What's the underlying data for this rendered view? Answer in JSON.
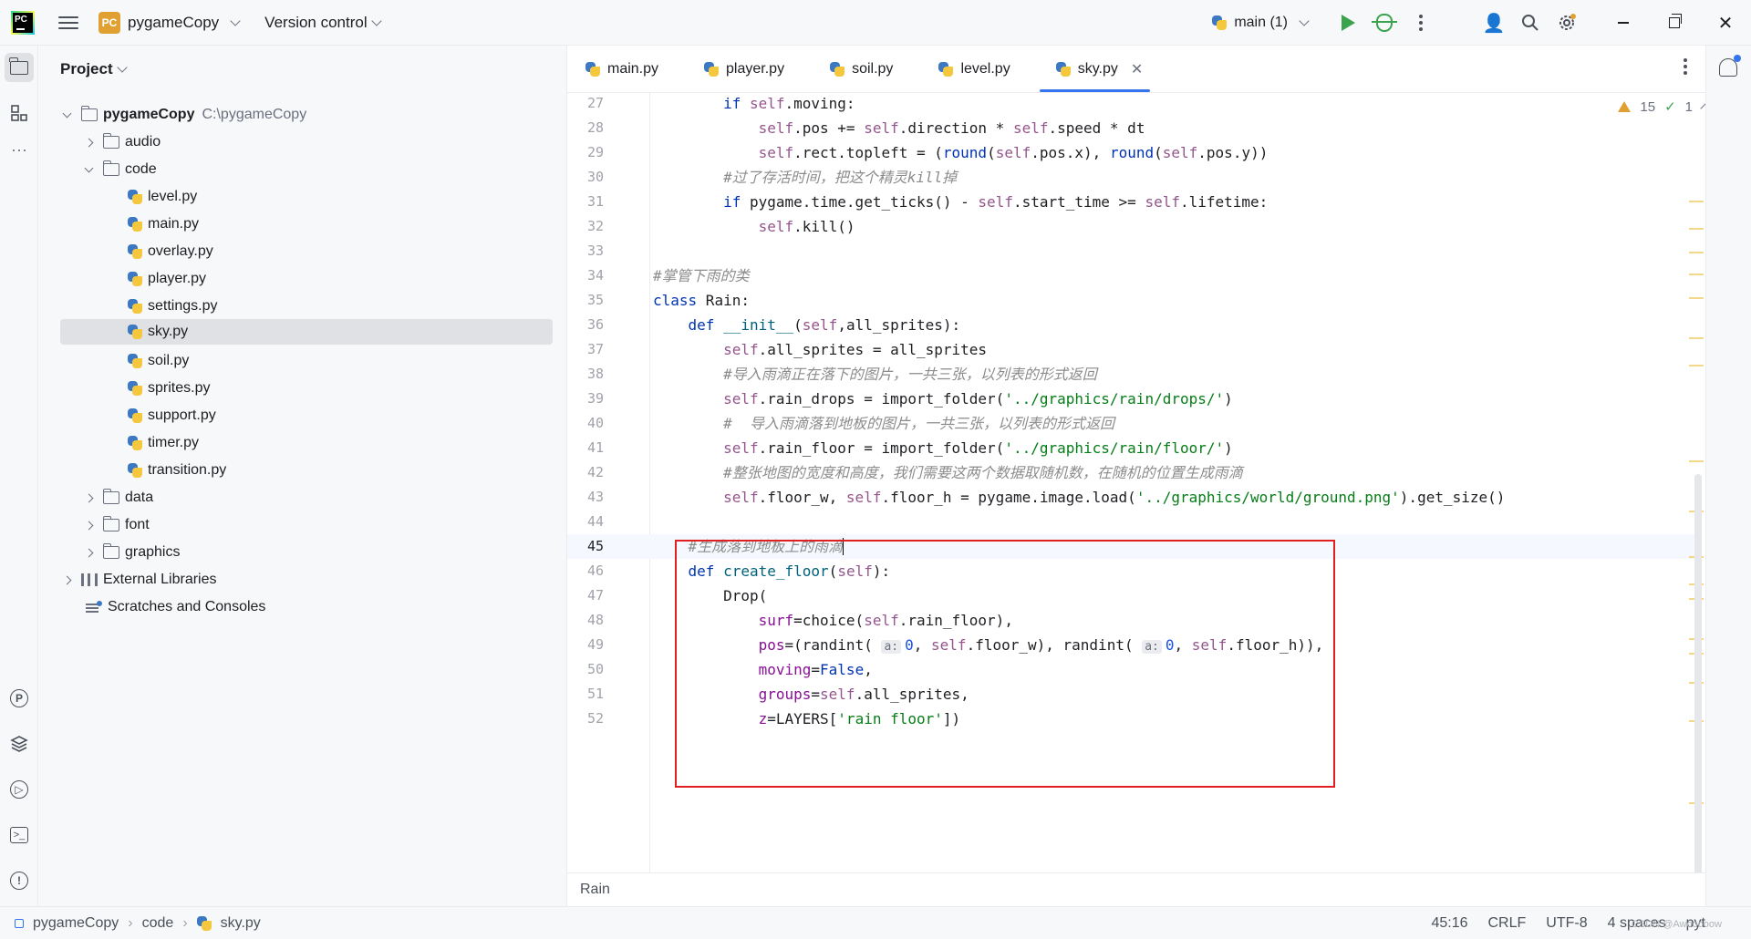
{
  "titlebar": {
    "project_badge": "PC",
    "project_name": "pygameCopy",
    "vcs_label": "Version control",
    "run_config": "main (1)"
  },
  "project_panel": {
    "title": "Project",
    "root_name": "pygameCopy",
    "root_path": "C:\\pygameCopy",
    "items": [
      {
        "label": "audio"
      },
      {
        "label": "code"
      },
      {
        "label": "level.py"
      },
      {
        "label": "main.py"
      },
      {
        "label": "overlay.py"
      },
      {
        "label": "player.py"
      },
      {
        "label": "settings.py"
      },
      {
        "label": "sky.py"
      },
      {
        "label": "soil.py"
      },
      {
        "label": "sprites.py"
      },
      {
        "label": "support.py"
      },
      {
        "label": "timer.py"
      },
      {
        "label": "transition.py"
      },
      {
        "label": "data"
      },
      {
        "label": "font"
      },
      {
        "label": "graphics"
      },
      {
        "label": "External Libraries"
      },
      {
        "label": "Scratches and Consoles"
      }
    ]
  },
  "tabs": [
    {
      "label": "main.py"
    },
    {
      "label": "player.py"
    },
    {
      "label": "soil.py"
    },
    {
      "label": "level.py"
    },
    {
      "label": "sky.py"
    }
  ],
  "inspections": {
    "warnings": "15",
    "ok": "1"
  },
  "editor": {
    "line_numbers": [
      "27",
      "28",
      "29",
      "30",
      "31",
      "32",
      "33",
      "34",
      "35",
      "36",
      "37",
      "38",
      "39",
      "40",
      "41",
      "42",
      "43",
      "44",
      "45",
      "46",
      "47",
      "48",
      "49",
      "50",
      "51",
      "52"
    ],
    "current_line": "45",
    "comments": {
      "l30": "#过了存活时间，把这个精灵kill掉",
      "l34": "#掌管下雨的类",
      "l38": "#导入雨滴正在落下的图片，一共三张，以列表的形式返回",
      "l40": "#  导入雨滴落到地板的图片，一共三张，以列表的形式返回",
      "l42": "#整张地图的宽度和高度，我们需要这两个数据取随机数，在随机的位置生成雨滴",
      "l45": "#生成落到地板上的雨滴"
    },
    "strings": {
      "drops": "'../graphics/rain/drops/'",
      "floor": "'../graphics/rain/floor/'",
      "ground": "'../graphics/world/ground.png'",
      "layer": "'rain floor'"
    }
  },
  "editor_breadcrumb": "Rain",
  "status": {
    "crumb_root": "pygameCopy",
    "crumb_folder": "code",
    "crumb_file": "sky.py",
    "position": "45:16",
    "line_sep": "CRLF",
    "encoding": "UTF-8",
    "indent": "4 spaces",
    "interpreter": "pyt",
    "watermark": "CSDN @Awooooow"
  }
}
